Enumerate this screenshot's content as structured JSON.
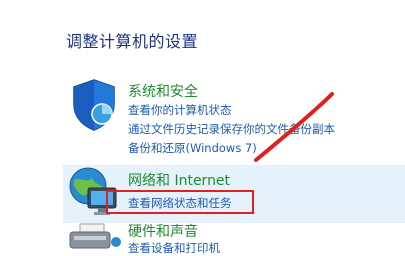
{
  "page": {
    "title": "调整计算机的设置"
  },
  "categories": {
    "security": {
      "title": "系统和安全",
      "links": [
        "查看你的计算机状态",
        "通过文件历史记录保存你的文件备份副本",
        "备份和还原(Windows 7)"
      ],
      "icon": "shield-icon"
    },
    "network": {
      "title": "网络和 Internet",
      "links": [
        "查看网络状态和任务"
      ],
      "icon": "globe-network-icon"
    },
    "hardware": {
      "title": "硬件和声音",
      "links": [
        "查看设备和打印机"
      ],
      "icon": "printer-icon"
    }
  },
  "colors": {
    "title": "#1e3287",
    "category": "#1c8d2e",
    "link": "#1f5bb3",
    "highlight": "#e02020",
    "hover_bg": "#e5f1fb"
  }
}
